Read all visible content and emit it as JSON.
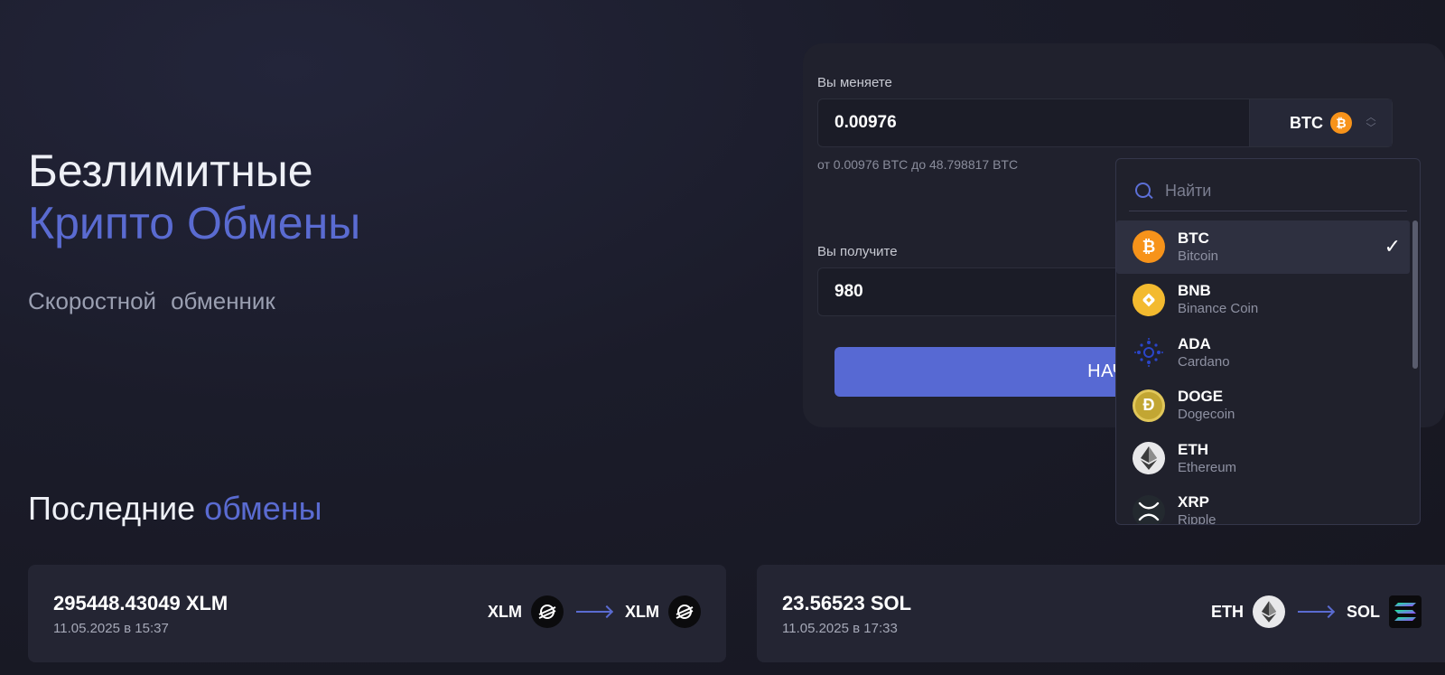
{
  "hero": {
    "line1": "Безлимитные",
    "line2": "Крипто Обмены",
    "subtitle_word1": "Скоростной",
    "subtitle_word2": "обменник"
  },
  "exchange": {
    "give_label": "Вы меняете",
    "give_value": "0.00976",
    "give_currency": "BTC",
    "range_text": "от 0.00976 BTC до 48.798817 BTC",
    "receive_label": "Вы получите",
    "receive_value": "980",
    "start_button": "НАЧАТЬ"
  },
  "currency_dropdown": {
    "search_placeholder": "Найти",
    "items": [
      {
        "code": "BTC",
        "name": "Bitcoin",
        "icon": "bitcoin-icon",
        "color": "#f7931a",
        "selected": true
      },
      {
        "code": "BNB",
        "name": "Binance Coin",
        "icon": "bnb-icon",
        "color": "#f3ba2f",
        "selected": false
      },
      {
        "code": "ADA",
        "name": "Cardano",
        "icon": "cardano-icon",
        "color": "#2a45c9",
        "selected": false
      },
      {
        "code": "DOGE",
        "name": "Dogecoin",
        "icon": "dogecoin-icon",
        "color": "#c2a633",
        "selected": false
      },
      {
        "code": "ETH",
        "name": "Ethereum",
        "icon": "ethereum-icon",
        "color": "#e8e8ea",
        "selected": false
      },
      {
        "code": "XRP",
        "name": "Ripple",
        "icon": "xrp-icon",
        "color": "#23292f",
        "selected": false
      }
    ]
  },
  "recent": {
    "title_part1": "Последние",
    "title_part2": "обмены",
    "cards": [
      {
        "amount": "295448.43049 XLM",
        "date": "11.05.2025 в 15:37",
        "from": "XLM",
        "to": "XLM",
        "from_icon": "stellar-icon",
        "to_icon": "stellar-icon"
      },
      {
        "amount": "23.56523 SOL",
        "date": "11.05.2025 в 17:33",
        "from": "ETH",
        "to": "SOL",
        "from_icon": "ethereum-icon",
        "to_icon": "solana-icon"
      }
    ]
  },
  "colors": {
    "accent": "#5a6bd1",
    "button": "#5769d3",
    "panel": "#20212d"
  }
}
